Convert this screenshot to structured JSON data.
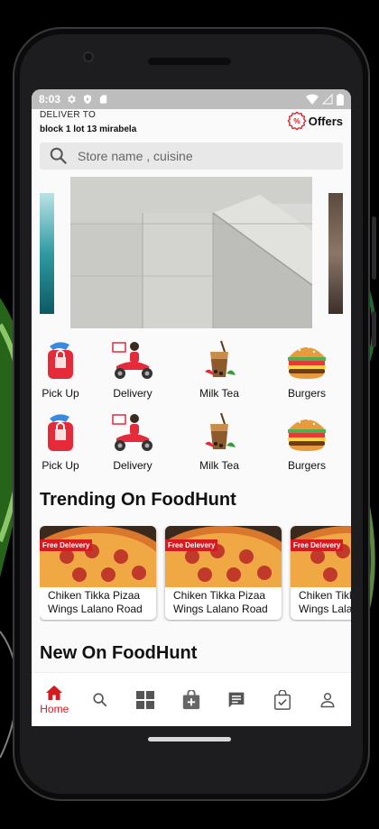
{
  "status_bar": {
    "time": "8:03"
  },
  "header": {
    "deliver_label": "DELIVER TO",
    "address": "block 1 lot 13 mirabela",
    "offers_label": "Offers"
  },
  "search": {
    "placeholder": "Store name , cuisine"
  },
  "categories": [
    {
      "label": "Pick Up",
      "icon": "pickup-bag-icon"
    },
    {
      "label": "Delivery",
      "icon": "delivery-scooter-icon"
    },
    {
      "label": "Milk Tea",
      "icon": "milk-tea-icon"
    },
    {
      "label": "Burgers",
      "icon": "burger-icon"
    }
  ],
  "sections": {
    "trending_title": "Trending On FoodHunt",
    "new_title": "New On FoodHunt"
  },
  "trending": [
    {
      "badge": "Free Delevery",
      "name": "Chiken Tikka Pizaa",
      "sub": "Wings  Lalano Road"
    },
    {
      "badge": "Free Delevery",
      "name": "Chiken Tikka Pizaa",
      "sub": "Wings  Lalano Road"
    },
    {
      "badge": "Free Delevery",
      "name": "Chiken Tikka Pizaa",
      "sub": "Wings  Lalano Road"
    }
  ],
  "bottom_nav": {
    "active": "Home",
    "items": [
      {
        "label": "Home",
        "icon": "home-icon"
      },
      {
        "icon": "search-icon"
      },
      {
        "icon": "grid-icon"
      },
      {
        "icon": "add-bag-icon"
      },
      {
        "icon": "chat-icon"
      },
      {
        "icon": "checked-bag-icon"
      },
      {
        "icon": "person-icon"
      }
    ]
  },
  "colors": {
    "accent": "#d71920",
    "status_bar": "#bdbdbd",
    "search_bg": "#e8e8e8"
  }
}
